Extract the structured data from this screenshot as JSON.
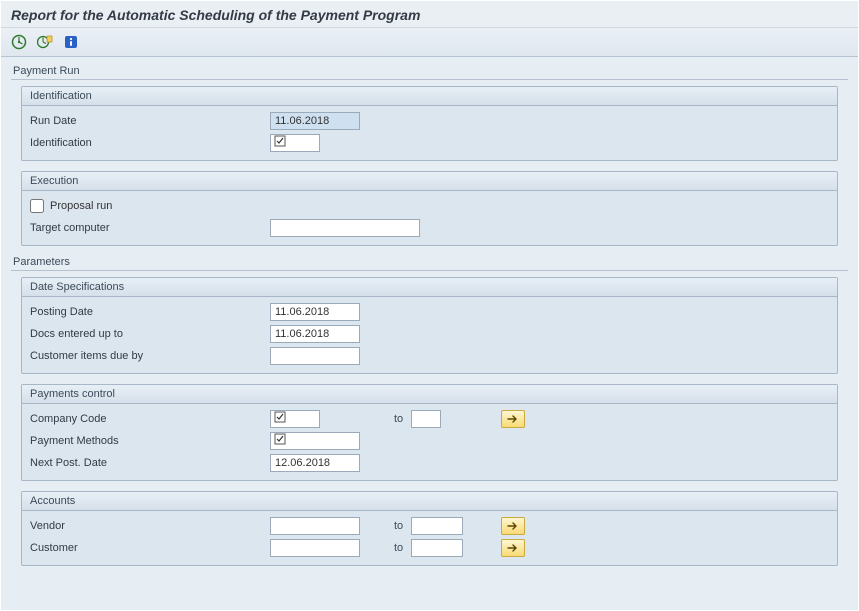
{
  "title": "Report for the Automatic Scheduling of the Payment Program",
  "toolbar": {
    "execute_icon": "execute-icon",
    "execute_plus_icon": "execute-plus-icon",
    "info_icon": "info-icon"
  },
  "sections": {
    "payment_run": {
      "title": "Payment Run",
      "identification": {
        "title": "Identification",
        "run_date_label": "Run Date",
        "run_date_value": "11.06.2018",
        "identification_label": "Identification",
        "identification_value": ""
      },
      "execution": {
        "title": "Execution",
        "proposal_run_label": "Proposal run",
        "proposal_run_checked": false,
        "target_computer_label": "Target computer",
        "target_computer_value": ""
      }
    },
    "parameters": {
      "title": "Parameters",
      "date_spec": {
        "title": "Date Specifications",
        "posting_date_label": "Posting Date",
        "posting_date_value": "11.06.2018",
        "docs_upto_label": "Docs entered up to",
        "docs_upto_value": "11.06.2018",
        "cust_due_label": "Customer items due by",
        "cust_due_value": ""
      },
      "pay_control": {
        "title": "Payments control",
        "company_code_label": "Company Code",
        "company_code_from": "",
        "to_label": "to",
        "company_code_to": "",
        "payment_methods_label": "Payment Methods",
        "payment_methods_value": "",
        "next_post_date_label": "Next Post. Date",
        "next_post_date_value": "12.06.2018"
      },
      "accounts": {
        "title": "Accounts",
        "vendor_label": "Vendor",
        "vendor_from": "",
        "vendor_to": "",
        "customer_label": "Customer",
        "customer_from": "",
        "customer_to": ""
      }
    }
  }
}
